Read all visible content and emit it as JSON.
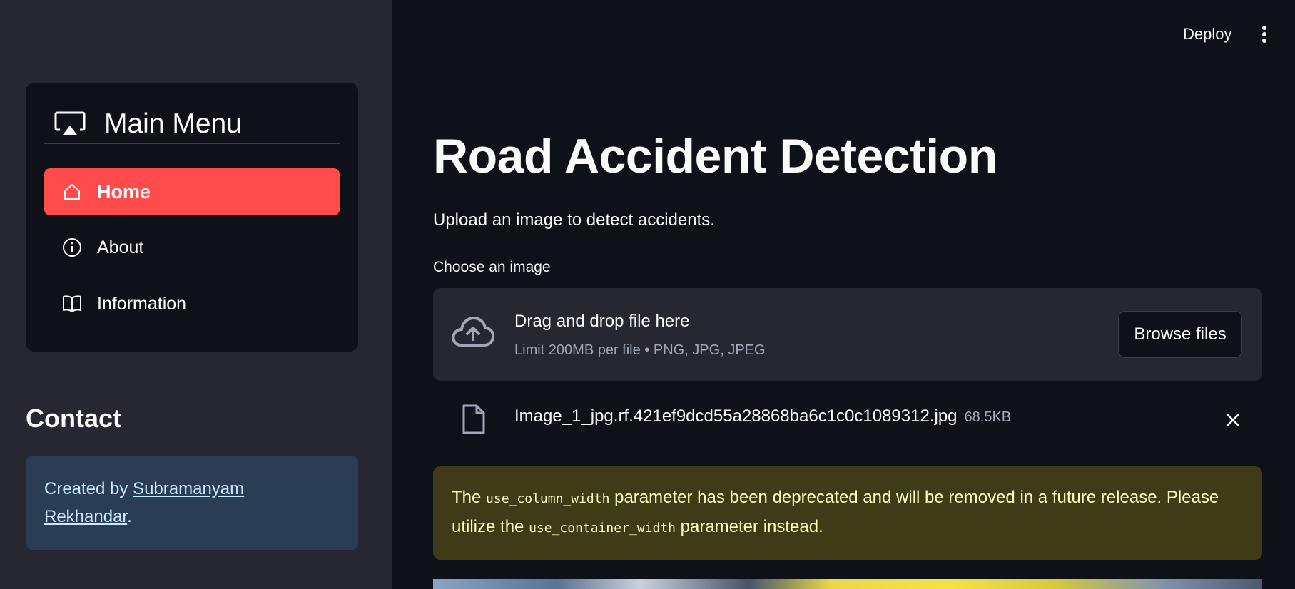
{
  "sidebar": {
    "menu_title": "Main Menu",
    "items": [
      {
        "label": "Home",
        "icon": "house-icon",
        "active": true
      },
      {
        "label": "About",
        "icon": "info-circle-icon",
        "active": false
      },
      {
        "label": "Information",
        "icon": "book-icon",
        "active": false
      }
    ],
    "contact": {
      "title": "Contact",
      "prefix": "Created by ",
      "link_text_line1": "Subramanyam",
      "link_text_line2": "Rekhandar",
      "suffix": "."
    }
  },
  "header": {
    "deploy_label": "Deploy"
  },
  "main": {
    "title": "Road Accident Detection",
    "subtitle": "Upload an image to detect accidents.",
    "uploader": {
      "label": "Choose an image",
      "drop_text": "Drag and drop file here",
      "hint": "Limit 200MB per file • PNG, JPG, JPEG",
      "browse_label": "Browse files"
    },
    "file": {
      "name": "Image_1_jpg.rf.421ef9dcd55a28868ba6c1c0c1089312.jpg",
      "size": "68.5KB"
    },
    "warning": {
      "part1": "The ",
      "code1": "use_column_width",
      "part2": " parameter has been deprecated and will be removed in a future release. Please utilize the ",
      "code2": "use_container_width",
      "part3": " parameter instead."
    }
  },
  "colors": {
    "accent": "#ff4b4b",
    "background": "#0e1117",
    "sidebar": "#262730",
    "info_box": "#2a3d55",
    "warning_box": "#3e3b16"
  }
}
